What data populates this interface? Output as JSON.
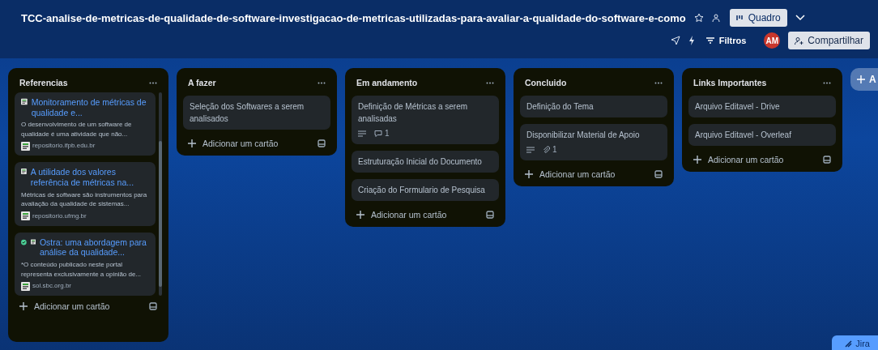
{
  "board": {
    "title": "TCC-analise-de-metricas-de-qualidade-de-software-investigacao-de-metricas-utilizadas-para-avaliar-a-qualidade-do-software-e-como",
    "starred": false,
    "view_button": "Quadro",
    "filter_button": "Filtros",
    "avatar": "AM",
    "share_button": "Compartilhar"
  },
  "lists": [
    {
      "title": "Referencias",
      "scrollable": true,
      "add_label": "Adicionar um cartão",
      "cards": [
        {
          "kind": "link",
          "completed": false,
          "title": "Monitoramento de métricas de qualidade e...",
          "description": "O desenvolvimento de um software de qualidade é uma atividade que não...",
          "domain": "repositorio.ifpb.edu.br"
        },
        {
          "kind": "link",
          "completed": false,
          "title": "A utilidade dos valores referência de métricas na...",
          "description": "Métricas de software são instrumentos para avaliação da qualidade de sistemas...",
          "domain": "repositorio.ufmg.br"
        },
        {
          "kind": "link",
          "completed": true,
          "title": "Ostra: uma abordagem para análise da qualidade...",
          "description": "*O conteúdo publicado neste portal representa exclusivamente a opinião de...",
          "domain": "sol.sbc.org.br"
        }
      ]
    },
    {
      "title": "A fazer",
      "scrollable": false,
      "add_label": "Adicionar um cartão",
      "cards": [
        {
          "kind": "text",
          "title": "Seleção dos Softwares a serem analisados",
          "has_description": false
        }
      ]
    },
    {
      "title": "Em andamento",
      "scrollable": false,
      "add_label": "Adicionar um cartão",
      "cards": [
        {
          "kind": "text",
          "title": "Definição de Métricas a serem analisadas",
          "has_description": true,
          "comments": "1"
        },
        {
          "kind": "text",
          "title": "Estruturação Inicial do Documento",
          "has_description": false
        },
        {
          "kind": "text",
          "title": "Criação do Formulario de Pesquisa",
          "has_description": false
        }
      ]
    },
    {
      "title": "Concluido",
      "scrollable": false,
      "add_label": "Adicionar um cartão",
      "cards": [
        {
          "kind": "text",
          "title": "Definição do Tema",
          "has_description": false
        },
        {
          "kind": "text",
          "title": "Disponibilizar Material de Apoio",
          "has_description": true,
          "attachments": "1"
        }
      ]
    },
    {
      "title": "Links Importantes",
      "scrollable": false,
      "add_label": "Adicionar um cartão",
      "cards": [
        {
          "kind": "text",
          "title": "Arquivo Editavel - Drive",
          "has_description": false
        },
        {
          "kind": "text",
          "title": "Arquivo Editavel - Overleaf",
          "has_description": false
        }
      ]
    }
  ],
  "add_list_button": "A",
  "jira_button": "Jira"
}
